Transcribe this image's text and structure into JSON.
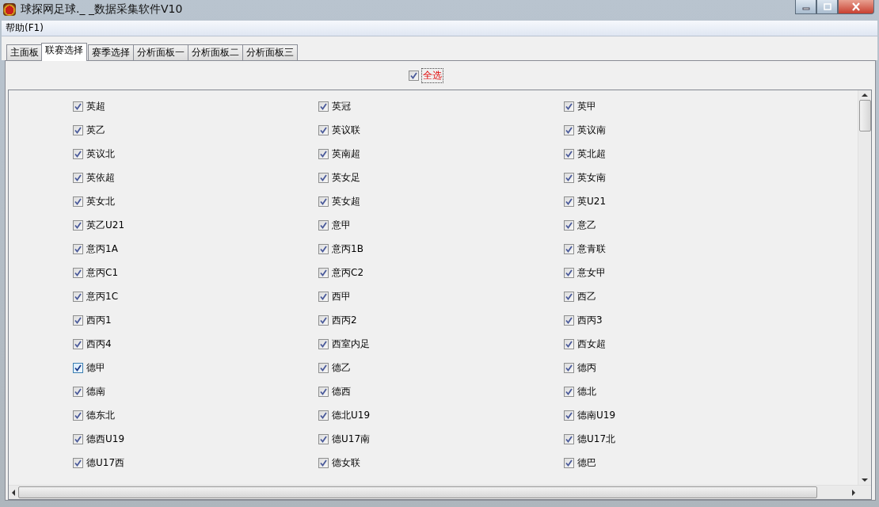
{
  "window": {
    "title": "球探网足球._ _数据采集软件V10"
  },
  "menu": [
    {
      "label": "帮助(F1)"
    }
  ],
  "tabs": [
    {
      "label": "主面板",
      "selected": false
    },
    {
      "label": "联赛选择",
      "selected": true
    },
    {
      "label": "赛季选择",
      "selected": false
    },
    {
      "label": "分析面板一",
      "selected": false
    },
    {
      "label": "分析面板二",
      "selected": false
    },
    {
      "label": "分析面板三",
      "selected": false
    }
  ],
  "select_all": {
    "label": "全选",
    "checked": true
  },
  "leagues": [
    {
      "label": "英超",
      "checked": true,
      "hovered": false
    },
    {
      "label": "英冠",
      "checked": true,
      "hovered": false
    },
    {
      "label": "英甲",
      "checked": true,
      "hovered": false
    },
    {
      "label": "英乙",
      "checked": true,
      "hovered": false
    },
    {
      "label": "英议联",
      "checked": true,
      "hovered": false
    },
    {
      "label": "英议南",
      "checked": true,
      "hovered": false
    },
    {
      "label": "英议北",
      "checked": true,
      "hovered": false
    },
    {
      "label": "英南超",
      "checked": true,
      "hovered": false
    },
    {
      "label": "英北超",
      "checked": true,
      "hovered": false
    },
    {
      "label": "英依超",
      "checked": true,
      "hovered": false
    },
    {
      "label": "英女足",
      "checked": true,
      "hovered": false
    },
    {
      "label": "英女南",
      "checked": true,
      "hovered": false
    },
    {
      "label": "英女北",
      "checked": true,
      "hovered": false
    },
    {
      "label": "英女超",
      "checked": true,
      "hovered": false
    },
    {
      "label": "英U21",
      "checked": true,
      "hovered": false
    },
    {
      "label": "英乙U21",
      "checked": true,
      "hovered": false
    },
    {
      "label": "意甲",
      "checked": true,
      "hovered": false
    },
    {
      "label": "意乙",
      "checked": true,
      "hovered": false
    },
    {
      "label": "意丙1A",
      "checked": true,
      "hovered": false
    },
    {
      "label": "意丙1B",
      "checked": true,
      "hovered": false
    },
    {
      "label": "意青联",
      "checked": true,
      "hovered": false
    },
    {
      "label": "意丙C1",
      "checked": true,
      "hovered": false
    },
    {
      "label": "意丙C2",
      "checked": true,
      "hovered": false
    },
    {
      "label": "意女甲",
      "checked": true,
      "hovered": false
    },
    {
      "label": "意丙1C",
      "checked": true,
      "hovered": false
    },
    {
      "label": "西甲",
      "checked": true,
      "hovered": false
    },
    {
      "label": "西乙",
      "checked": true,
      "hovered": false
    },
    {
      "label": "西丙1",
      "checked": true,
      "hovered": false
    },
    {
      "label": "西丙2",
      "checked": true,
      "hovered": false
    },
    {
      "label": "西丙3",
      "checked": true,
      "hovered": false
    },
    {
      "label": "西丙4",
      "checked": true,
      "hovered": false
    },
    {
      "label": "西室内足",
      "checked": true,
      "hovered": false
    },
    {
      "label": "西女超",
      "checked": true,
      "hovered": false
    },
    {
      "label": "德甲",
      "checked": true,
      "hovered": true
    },
    {
      "label": "德乙",
      "checked": true,
      "hovered": false
    },
    {
      "label": "德丙",
      "checked": true,
      "hovered": false
    },
    {
      "label": "德南",
      "checked": true,
      "hovered": false
    },
    {
      "label": "德西",
      "checked": true,
      "hovered": false
    },
    {
      "label": "德北",
      "checked": true,
      "hovered": false
    },
    {
      "label": "德东北",
      "checked": true,
      "hovered": false
    },
    {
      "label": "德北U19",
      "checked": true,
      "hovered": false
    },
    {
      "label": "德南U19",
      "checked": true,
      "hovered": false
    },
    {
      "label": "德西U19",
      "checked": true,
      "hovered": false
    },
    {
      "label": "德U17南",
      "checked": true,
      "hovered": false
    },
    {
      "label": "德U17北",
      "checked": true,
      "hovered": false
    },
    {
      "label": "德U17西",
      "checked": true,
      "hovered": false
    },
    {
      "label": "德女联",
      "checked": true,
      "hovered": false
    },
    {
      "label": "德巴",
      "checked": true,
      "hovered": false
    }
  ]
}
